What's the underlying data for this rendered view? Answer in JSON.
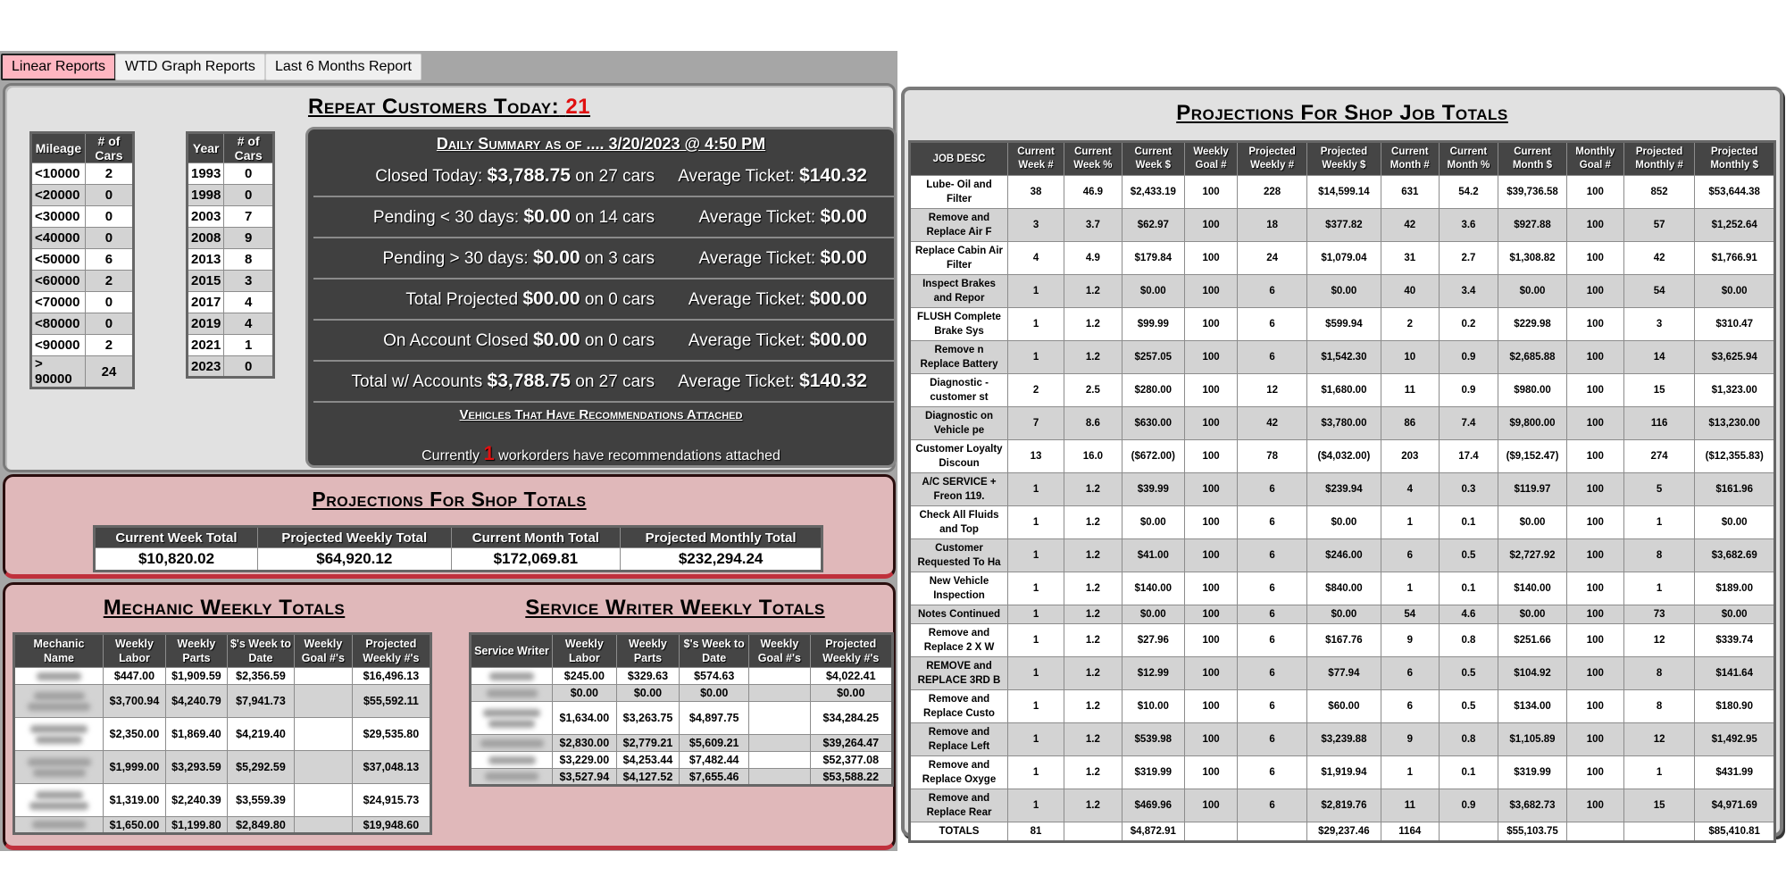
{
  "tabs": [
    {
      "label": "Linear Reports",
      "active": true
    },
    {
      "label": "WTD Graph Reports",
      "active": false
    },
    {
      "label": "Last 6 Months Report",
      "active": false
    }
  ],
  "repeat_customers": {
    "label": "Repeat Customers Today:",
    "count": "21"
  },
  "mileage_table": {
    "headers": [
      "Mileage",
      "# of Cars"
    ],
    "rows": [
      [
        "<10000",
        "2"
      ],
      [
        "<20000",
        "0"
      ],
      [
        "<30000",
        "0"
      ],
      [
        "<40000",
        "0"
      ],
      [
        "<50000",
        "6"
      ],
      [
        "<60000",
        "2"
      ],
      [
        "<70000",
        "0"
      ],
      [
        "<80000",
        "0"
      ],
      [
        "<90000",
        "2"
      ],
      [
        "> 90000",
        "24"
      ]
    ]
  },
  "year_table": {
    "headers": [
      "Year",
      "# of Cars"
    ],
    "rows": [
      [
        "1993",
        "0"
      ],
      [
        "1998",
        "0"
      ],
      [
        "2003",
        "7"
      ],
      [
        "2008",
        "9"
      ],
      [
        "2013",
        "8"
      ],
      [
        "2015",
        "3"
      ],
      [
        "2017",
        "4"
      ],
      [
        "2019",
        "4"
      ],
      [
        "2021",
        "1"
      ],
      [
        "2023",
        "0"
      ]
    ]
  },
  "daily_summary": {
    "title": "Daily Summary as of .... 3/20/2023 @ 4:50 PM",
    "rows": [
      {
        "label": "Closed Today:",
        "amount": "$3,788.75",
        "cars": "on 27 cars",
        "avg_label": "Average Ticket:",
        "avg": "$140.32"
      },
      {
        "label": "Pending < 30 days:",
        "amount": "$0.00",
        "cars": "on 14 cars",
        "avg_label": "Average Ticket:",
        "avg": "$0.00"
      },
      {
        "label": "Pending > 30 days:",
        "amount": "$0.00",
        "cars": "on 3 cars",
        "avg_label": "Average Ticket:",
        "avg": "$0.00"
      },
      {
        "label": "Total Projected",
        "amount": "$00.00",
        "cars": "on 0 cars",
        "avg_label": "Average Ticket:",
        "avg": "$00.00"
      },
      {
        "label": "On Account Closed",
        "amount": "$0.00",
        "cars": "on 0 cars",
        "avg_label": "Average Ticket:",
        "avg": "$00.00"
      },
      {
        "label": "Total w/ Accounts",
        "amount": "$3,788.75",
        "cars": "on 27 cars",
        "avg_label": "Average Ticket:",
        "avg": "$140.32"
      }
    ],
    "recs_title": "Vehicles That Have Recommendations Attached",
    "recs_prefix": "Currently",
    "recs_count": "1",
    "recs_suffix": "workorders have recommendations attached"
  },
  "shop_totals": {
    "title": "Projections For Shop Totals",
    "headers": [
      "Current Week Total",
      "Projected Weekly Total",
      "Current Month Total",
      "Projected Monthly Total"
    ],
    "values": [
      "$10,820.02",
      "$64,920.12",
      "$172,069.81",
      "$232,294.24"
    ]
  },
  "mechanic_totals": {
    "title": "Mechanic Weekly Totals",
    "headers": [
      "Mechanic Name",
      "Weekly Labor",
      "Weekly Parts",
      "$'s Week to Date",
      "Weekly Goal #'s",
      "Projected Weekly #'s"
    ],
    "rows": [
      {
        "name_lines": 1,
        "values": [
          "$447.00",
          "$1,909.59",
          "$2,356.59",
          "",
          "$16,496.13"
        ]
      },
      {
        "name_lines": 2,
        "values": [
          "$3,700.94",
          "$4,240.79",
          "$7,941.73",
          "",
          "$55,592.11"
        ]
      },
      {
        "name_lines": 2,
        "values": [
          "$2,350.00",
          "$1,869.40",
          "$4,219.40",
          "",
          "$29,535.80"
        ]
      },
      {
        "name_lines": 2,
        "values": [
          "$1,999.00",
          "$3,293.59",
          "$5,292.59",
          "",
          "$37,048.13"
        ]
      },
      {
        "name_lines": 2,
        "values": [
          "$1,319.00",
          "$2,240.39",
          "$3,559.39",
          "",
          "$24,915.73"
        ]
      },
      {
        "name_lines": 1,
        "values": [
          "$1,650.00",
          "$1,199.80",
          "$2,849.80",
          "",
          "$19,948.60"
        ]
      }
    ]
  },
  "writer_totals": {
    "title": "Service Writer Weekly Totals",
    "headers": [
      "Service Writer",
      "Weekly Labor",
      "Weekly Parts",
      "$'s Week to Date",
      "Weekly Goal #'s",
      "Projected Weekly #'s"
    ],
    "rows": [
      {
        "name_lines": 1,
        "values": [
          "$245.00",
          "$329.63",
          "$574.63",
          "",
          "$4,022.41"
        ]
      },
      {
        "name_lines": 1,
        "values": [
          "$0.00",
          "$0.00",
          "$0.00",
          "",
          "$0.00"
        ]
      },
      {
        "name_lines": 2,
        "values": [
          "$1,634.00",
          "$3,263.75",
          "$4,897.75",
          "",
          "$34,284.25"
        ]
      },
      {
        "name_lines": 1,
        "values": [
          "$2,830.00",
          "$2,779.21",
          "$5,609.21",
          "",
          "$39,264.47"
        ]
      },
      {
        "name_lines": 1,
        "values": [
          "$3,229.00",
          "$4,253.44",
          "$7,482.44",
          "",
          "$52,377.08"
        ]
      },
      {
        "name_lines": 1,
        "values": [
          "$3,527.94",
          "$4,127.52",
          "$7,655.46",
          "",
          "$53,588.22"
        ]
      }
    ]
  },
  "job_totals": {
    "title": "Projections For Shop Job Totals",
    "headers": [
      "JOB DESC",
      "Current Week #",
      "Current Week %",
      "Current Week $",
      "Weekly Goal #",
      "Projected Weekly #",
      "Projected Weekly $",
      "Current Month #",
      "Current Month %",
      "Current Month $",
      "Monthly Goal #",
      "Projected Monthly #",
      "Projected Monthly $"
    ],
    "rows": [
      [
        "Lube- Oil and Filter",
        "38",
        "46.9",
        "$2,433.19",
        "100",
        "228",
        "$14,599.14",
        "631",
        "54.2",
        "$39,736.58",
        "100",
        "852",
        "$53,644.38"
      ],
      [
        "Remove and Replace Air F",
        "3",
        "3.7",
        "$62.97",
        "100",
        "18",
        "$377.82",
        "42",
        "3.6",
        "$927.88",
        "100",
        "57",
        "$1,252.64"
      ],
      [
        "Replace Cabin Air Filter",
        "4",
        "4.9",
        "$179.84",
        "100",
        "24",
        "$1,079.04",
        "31",
        "2.7",
        "$1,308.82",
        "100",
        "42",
        "$1,766.91"
      ],
      [
        "Inspect Brakes and Repor",
        "1",
        "1.2",
        "$0.00",
        "100",
        "6",
        "$0.00",
        "40",
        "3.4",
        "$0.00",
        "100",
        "54",
        "$0.00"
      ],
      [
        "FLUSH Complete Brake Sys",
        "1",
        "1.2",
        "$99.99",
        "100",
        "6",
        "$599.94",
        "2",
        "0.2",
        "$229.98",
        "100",
        "3",
        "$310.47"
      ],
      [
        "Remove n Replace Battery",
        "1",
        "1.2",
        "$257.05",
        "100",
        "6",
        "$1,542.30",
        "10",
        "0.9",
        "$2,685.88",
        "100",
        "14",
        "$3,625.94"
      ],
      [
        "Diagnostic - customer st",
        "2",
        "2.5",
        "$280.00",
        "100",
        "12",
        "$1,680.00",
        "11",
        "0.9",
        "$980.00",
        "100",
        "15",
        "$1,323.00"
      ],
      [
        "Diagnostic on Vehicle pe",
        "7",
        "8.6",
        "$630.00",
        "100",
        "42",
        "$3,780.00",
        "86",
        "7.4",
        "$9,800.00",
        "100",
        "116",
        "$13,230.00"
      ],
      [
        "Customer Loyalty Discoun",
        "13",
        "16.0",
        "($672.00)",
        "100",
        "78",
        "($4,032.00)",
        "203",
        "17.4",
        "($9,152.47)",
        "100",
        "274",
        "($12,355.83)"
      ],
      [
        "A/C SERVICE + Freon 119.",
        "1",
        "1.2",
        "$39.99",
        "100",
        "6",
        "$239.94",
        "4",
        "0.3",
        "$119.97",
        "100",
        "5",
        "$161.96"
      ],
      [
        "Check All Fluids and Top",
        "1",
        "1.2",
        "$0.00",
        "100",
        "6",
        "$0.00",
        "1",
        "0.1",
        "$0.00",
        "100",
        "1",
        "$0.00"
      ],
      [
        "Customer Requested To Ha",
        "1",
        "1.2",
        "$41.00",
        "100",
        "6",
        "$246.00",
        "6",
        "0.5",
        "$2,727.92",
        "100",
        "8",
        "$3,682.69"
      ],
      [
        "New Vehicle Inspection",
        "1",
        "1.2",
        "$140.00",
        "100",
        "6",
        "$840.00",
        "1",
        "0.1",
        "$140.00",
        "100",
        "1",
        "$189.00"
      ],
      [
        "Notes Continued",
        "1",
        "1.2",
        "$0.00",
        "100",
        "6",
        "$0.00",
        "54",
        "4.6",
        "$0.00",
        "100",
        "73",
        "$0.00"
      ],
      [
        "Remove and Replace 2 X W",
        "1",
        "1.2",
        "$27.96",
        "100",
        "6",
        "$167.76",
        "9",
        "0.8",
        "$251.66",
        "100",
        "12",
        "$339.74"
      ],
      [
        "REMOVE and REPLACE 3RD B",
        "1",
        "1.2",
        "$12.99",
        "100",
        "6",
        "$77.94",
        "6",
        "0.5",
        "$104.92",
        "100",
        "8",
        "$141.64"
      ],
      [
        "Remove and Replace Custo",
        "1",
        "1.2",
        "$10.00",
        "100",
        "6",
        "$60.00",
        "6",
        "0.5",
        "$134.00",
        "100",
        "8",
        "$180.90"
      ],
      [
        "Remove and Replace Left",
        "1",
        "1.2",
        "$539.98",
        "100",
        "6",
        "$3,239.88",
        "9",
        "0.8",
        "$1,105.89",
        "100",
        "12",
        "$1,492.95"
      ],
      [
        "Remove and Replace Oxyge",
        "1",
        "1.2",
        "$319.99",
        "100",
        "6",
        "$1,919.94",
        "1",
        "0.1",
        "$319.99",
        "100",
        "1",
        "$431.99"
      ],
      [
        "Remove and Replace Rear",
        "1",
        "1.2",
        "$469.96",
        "100",
        "6",
        "$2,819.76",
        "11",
        "0.9",
        "$3,682.73",
        "100",
        "15",
        "$4,971.69"
      ]
    ],
    "totals": [
      "TOTALS",
      "81",
      "",
      "$4,872.91",
      "",
      "",
      "$29,237.46",
      "1164",
      "",
      "$55,103.75",
      "",
      "",
      "$85,410.81"
    ]
  }
}
